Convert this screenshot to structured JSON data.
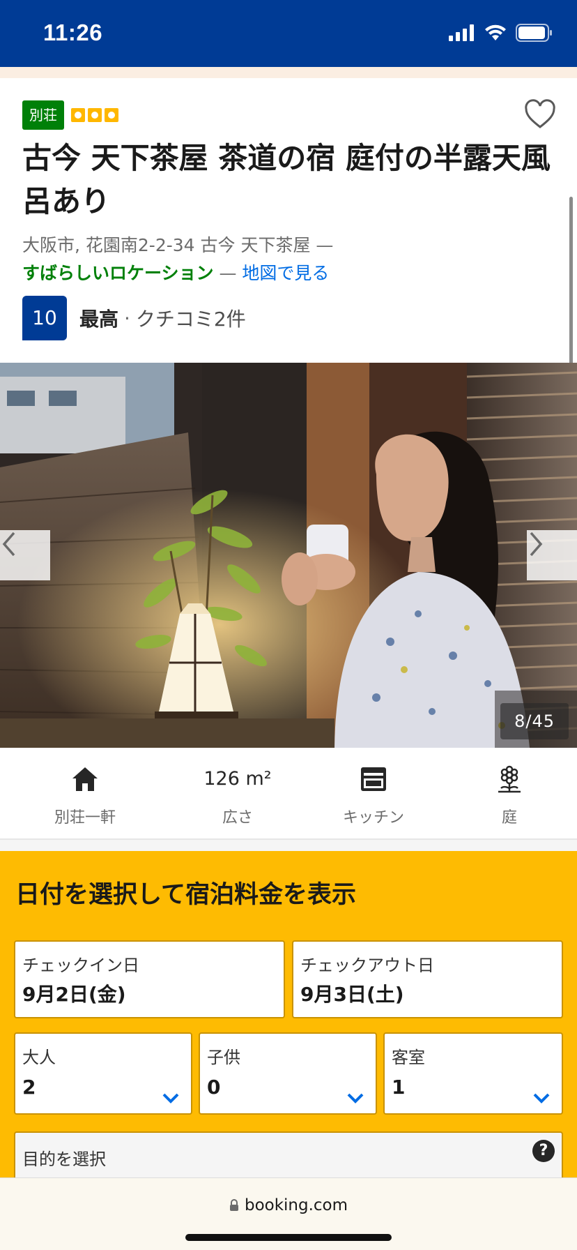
{
  "status_bar": {
    "time": "11:26"
  },
  "property": {
    "type_badge": "別荘",
    "star_count": 3,
    "title": "古今 天下茶屋 茶道の宿 庭付の半露天風呂あり",
    "address": "大阪市, 花園南2-2-34 古今 天下茶屋 —",
    "location_rating": "すばらしいロケーション",
    "location_sep": "—",
    "map_link": "地図で見る",
    "score": "10",
    "score_word": "最高",
    "score_sep": "·",
    "reviews": "クチコミ2件"
  },
  "gallery": {
    "counter": "8/45"
  },
  "facilities": [
    {
      "icon": "house-icon",
      "label": "別荘一軒"
    },
    {
      "value": "126 m²",
      "label": "広さ"
    },
    {
      "icon": "kitchen-icon",
      "label": "キッチン"
    },
    {
      "icon": "flower-icon",
      "label": "庭"
    }
  ],
  "booking": {
    "title": "日付を選択して宿泊料金を表示",
    "checkin_label": "チェックイン日",
    "checkin_value": "9月2日(金)",
    "checkout_label": "チェックアウト日",
    "checkout_value": "9月3日(土)",
    "adults_label": "大人",
    "adults_value": "2",
    "children_label": "子供",
    "children_value": "0",
    "rooms_label": "客室",
    "rooms_value": "1",
    "purpose_label": "目的を選択",
    "help": "?"
  },
  "browser": {
    "url": "booking.com"
  },
  "colors": {
    "brand_blue": "#003b95",
    "yellow": "#febb02",
    "green": "#008009",
    "link": "#006ce4"
  }
}
